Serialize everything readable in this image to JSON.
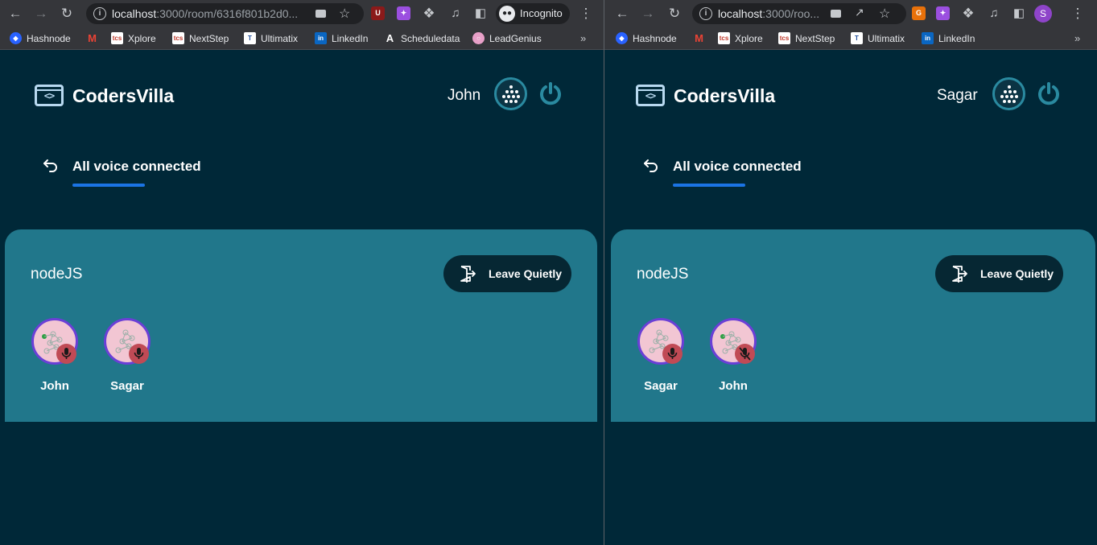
{
  "colors": {
    "page_bg": "#002838",
    "card_bg": "#21778b",
    "accent_underline": "#1b74e4",
    "avatar_ring": "#6a3fd6",
    "mic_badge": "#c04a55",
    "button_bg": "#062733"
  },
  "left_window": {
    "browser": {
      "url_host": "localhost",
      "url_rest": ":3000/room/6316f801b2d0...",
      "incognito_label": "Incognito",
      "bookmarks": [
        "Hashnode",
        "Xplore",
        "NextStep",
        "Ultimatix",
        "LinkedIn",
        "Scheduledata",
        "LeadGenius"
      ]
    },
    "app": {
      "logo_text": "CodersVilla",
      "user_name": "John",
      "nav_title": "All voice connected",
      "room": {
        "topic": "nodeJS",
        "leave_label": "Leave Quietly",
        "speakers": [
          {
            "name": "John",
            "muted": false
          },
          {
            "name": "Sagar",
            "muted": false
          }
        ]
      }
    }
  },
  "right_window": {
    "browser": {
      "url_host": "localhost",
      "url_rest": ":3000/roo...",
      "profile_initial": "S",
      "bookmarks": [
        "Hashnode",
        "Xplore",
        "NextStep",
        "Ultimatix",
        "LinkedIn"
      ]
    },
    "app": {
      "logo_text": "CodersVilla",
      "user_name": "Sagar",
      "nav_title": "All voice connected",
      "room": {
        "topic": "nodeJS",
        "leave_label": "Leave Quietly",
        "speakers": [
          {
            "name": "Sagar",
            "muted": false
          },
          {
            "name": "John",
            "muted": true
          }
        ]
      }
    }
  }
}
